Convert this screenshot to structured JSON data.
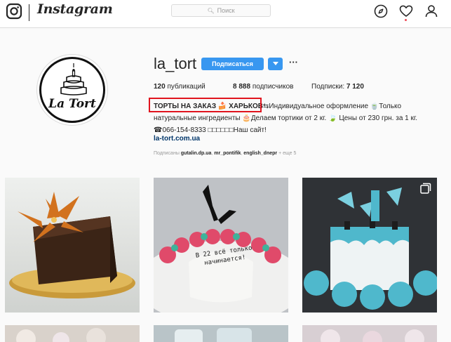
{
  "nav": {
    "wordmark": "Instagram",
    "search_placeholder": "Поиск"
  },
  "profile": {
    "username": "la_tort",
    "avatar_text": "La Tort",
    "follow_label": "Подписаться",
    "more_label": "···",
    "stats": {
      "posts_num": "120",
      "posts_label": "публикаций",
      "followers_num": "8 888",
      "followers_label": "подписчиков",
      "following_label": "Подписки:",
      "following_num": "7 120"
    },
    "bio": {
      "line1_highlight": "ТОРТЫ НА ЗАКАЗ 🍰 ХАРЬКОВ",
      "line1_rest": "⇆Индивидуальное оформление 🍵Только",
      "line2": "натуральные ингредиенты 🎂Делаем тортики от 2 кг. 🍃 Цены от 230 грн. за 1 кг.",
      "line3": "☎066-154-8333 □□□□□□Наш сайт!"
    },
    "website": "la-tort.com.ua",
    "followed_by": {
      "prefix": "Подписаны",
      "user1": "gutalin.dp.ua",
      "user2": "mr_pontifik",
      "user3": "english_dnepr",
      "suffix": "+ еще 5"
    }
  },
  "post1": {
    "cake_text": "В 22 всё только начинается!"
  },
  "colors": {
    "accent": "#3897f0",
    "highlight_box": "#e0141e",
    "link": "#003569",
    "notification_dot": "#ed4956"
  }
}
